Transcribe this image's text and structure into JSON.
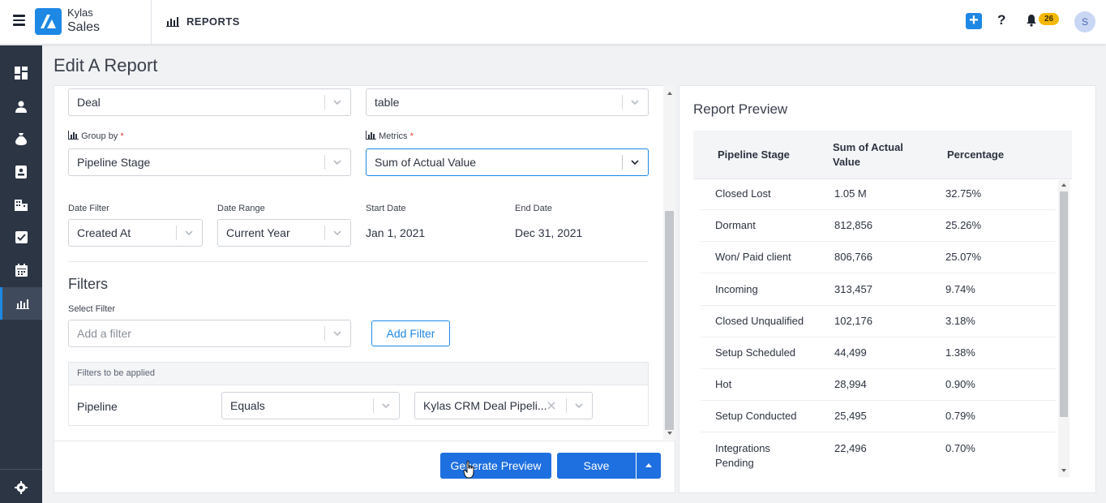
{
  "app": {
    "brand_top": "Kylas",
    "brand_bottom": "Sales",
    "section": "REPORTS",
    "notif_count": "26",
    "avatar_initial": "S",
    "help": "?",
    "plus": "+"
  },
  "page": {
    "title": "Edit A Report"
  },
  "form": {
    "entity_value": "Deal",
    "type_value": "table",
    "group_by_label": "Group by",
    "group_by_value": "Pipeline Stage",
    "metrics_label": "Metrics",
    "metrics_value": "Sum of Actual Value",
    "required_mark": "*",
    "date_filter_label": "Date Filter",
    "date_filter_value": "Created At",
    "date_range_label": "Date Range",
    "date_range_value": "Current Year",
    "start_date_label": "Start Date",
    "start_date_value": "Jan 1, 2021",
    "end_date_label": "End Date",
    "end_date_value": "Dec 31, 2021"
  },
  "filters": {
    "title": "Filters",
    "select_label": "Select Filter",
    "select_placeholder": "Add a filter",
    "add_button": "Add Filter",
    "applied_title": "Filters to be applied",
    "rows": [
      {
        "field": "Pipeline",
        "operator": "Equals",
        "value": "Kylas CRM Deal Pipeli..."
      }
    ]
  },
  "actions": {
    "generate_preview": "Generate Preview",
    "save": "Save"
  },
  "preview": {
    "title": "Report Preview",
    "columns": [
      "Pipeline Stage",
      "Sum of Actual Value",
      "Percentage"
    ],
    "rows": [
      {
        "stage": "Closed Lost",
        "sum": "1.05 M",
        "pct": "32.75%"
      },
      {
        "stage": "Dormant",
        "sum": "812,856",
        "pct": "25.26%"
      },
      {
        "stage": "Won/ Paid client",
        "sum": "806,766",
        "pct": "25.07%"
      },
      {
        "stage": "Incoming",
        "sum": "313,457",
        "pct": "9.74%"
      },
      {
        "stage": "Closed Unqualified",
        "sum": "102,176",
        "pct": "3.18%"
      },
      {
        "stage": "Setup Scheduled",
        "sum": "44,499",
        "pct": "1.38%"
      },
      {
        "stage": "Hot",
        "sum": "28,994",
        "pct": "0.90%"
      },
      {
        "stage": "Setup Conducted",
        "sum": "25,495",
        "pct": "0.79%"
      },
      {
        "stage": "Integrations Pending",
        "sum": "22,496",
        "pct": "0.70%"
      }
    ]
  },
  "colors": {
    "accent": "#1e88e5",
    "sidebar": "#2b3544",
    "badge": "#f5b800"
  },
  "icons": [
    "menu-icon",
    "kylas-logo-icon",
    "reports-icon",
    "plus-icon",
    "help-icon",
    "bell-icon",
    "dashboard-icon",
    "contacts-icon",
    "deals-icon",
    "leads-icon",
    "companies-icon",
    "tasks-icon",
    "calendar-icon",
    "settings-icon",
    "chevron-down-icon",
    "clear-icon"
  ]
}
